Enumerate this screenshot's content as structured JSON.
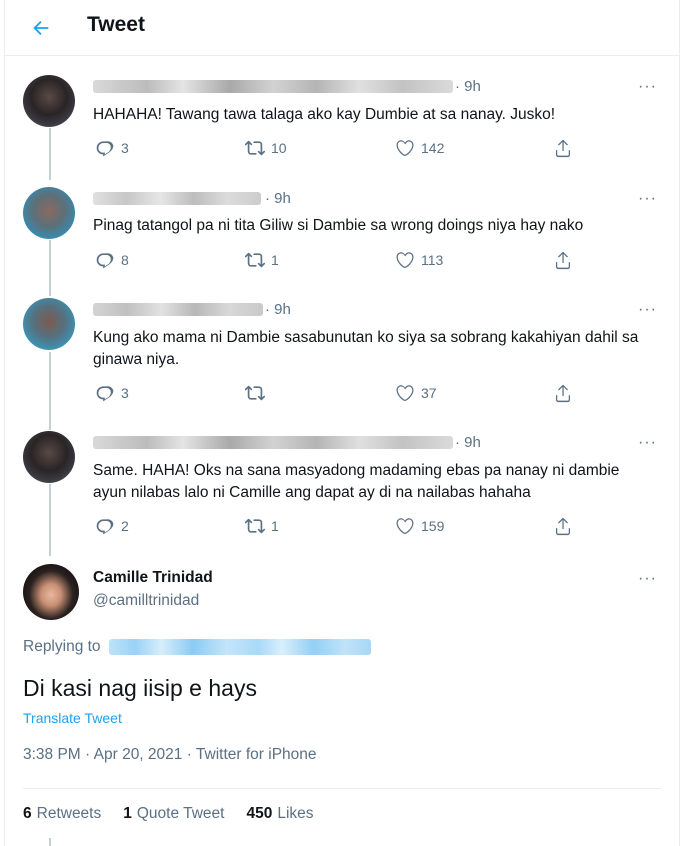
{
  "header": {
    "title": "Tweet"
  },
  "replies": [
    {
      "time": "· 9h",
      "text": "HAHAHA! Tawang tawa talaga ako kay Dumbie at sa nanay. Jusko!",
      "reply_count": "3",
      "retweet_count": "10",
      "like_count": "142"
    },
    {
      "time": "· 9h",
      "text": "Pinag tatangol pa ni tita Giliw si Dambie sa wrong doings niya hay nako",
      "reply_count": "8",
      "retweet_count": "1",
      "like_count": "113"
    },
    {
      "time": "· 9h",
      "text": "Kung ako mama ni Dambie sasabunutan ko siya sa sobrang kakahiyan dahil sa ginawa niya.",
      "reply_count": "3",
      "retweet_count": "",
      "like_count": "37"
    },
    {
      "time": "· 9h",
      "text": "Same. HAHA! Oks na sana masyadong madaming ebas pa nanay ni dambie ayun nilabas lalo ni Camille ang dapat ay di na nailabas hahaha",
      "reply_count": "2",
      "retweet_count": "1",
      "like_count": "159"
    }
  ],
  "main_tweet": {
    "display_name": "Camille Trinidad",
    "handle": "@camilltrinidad",
    "replying_to_label": "Replying to",
    "text": "Di kasi nag iisip e hays",
    "translate_label": "Translate Tweet",
    "meta": "3:38 PM · Apr 20, 2021 · Twitter for iPhone",
    "stats": {
      "retweets_count": "6",
      "retweets_label": "Retweets",
      "quotes_count": "1",
      "quotes_label": "Quote Tweet",
      "likes_count": "450",
      "likes_label": "Likes"
    }
  },
  "more_label": "···",
  "colors": {
    "accent": "#1da1f2",
    "secondary_text": "#5b7083",
    "border": "#ebeef0"
  },
  "icons": [
    "back-arrow-icon",
    "reply-icon",
    "retweet-icon",
    "like-icon",
    "share-icon",
    "more-icon"
  ]
}
